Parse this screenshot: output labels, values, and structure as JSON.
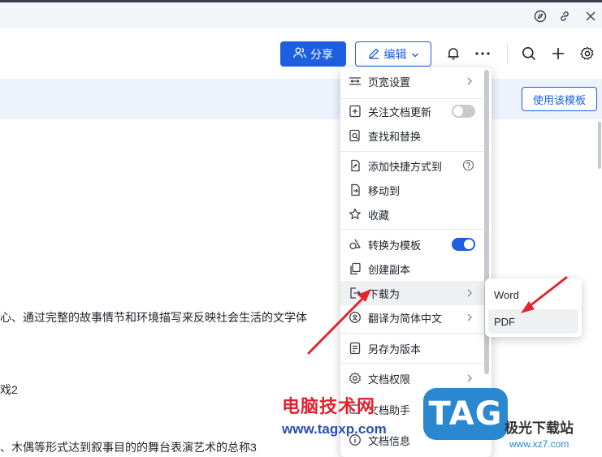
{
  "window_controls": {
    "compass_icon": "compass-icon",
    "link_icon": "link-icon",
    "close_icon": "close-icon"
  },
  "header": {
    "share_label": "分享",
    "edit_label": "编辑"
  },
  "banner": {
    "template_button": "使用该模板"
  },
  "doc_lines": [
    "心、通过完整的故事情节和环境描写来反映社会生活的文学体",
    "戏2",
    "、木偶等形式达到叙事目的的舞台表演艺术的总称3"
  ],
  "menu": {
    "items": [
      {
        "label": "页宽设置",
        "icon": "page-width-icon",
        "has_arrow": true
      },
      {
        "label": "关注文档更新",
        "icon": "follow-icon",
        "toggle": false
      },
      {
        "label": "查找和替换",
        "icon": "find-replace-icon"
      },
      {
        "label": "添加快捷方式到",
        "icon": "shortcut-icon",
        "has_help": true
      },
      {
        "label": "移动到",
        "icon": "move-icon"
      },
      {
        "label": "收藏",
        "icon": "star-icon"
      },
      {
        "label": "转换为模板",
        "icon": "template-icon",
        "toggle": true
      },
      {
        "label": "创建副本",
        "icon": "copy-icon"
      },
      {
        "label": "下载为",
        "icon": "download-icon",
        "has_arrow": true,
        "highlighted": true
      },
      {
        "label": "翻译为简体中文",
        "icon": "translate-icon",
        "has_arrow": true
      },
      {
        "label": "另存为版本",
        "icon": "save-version-icon"
      },
      {
        "label": "文档权限",
        "icon": "permission-icon",
        "has_arrow": true
      },
      {
        "label": "文档助手",
        "icon": "assistant-icon"
      },
      {
        "label": "文档信息",
        "icon": "info-icon"
      }
    ]
  },
  "submenu": {
    "items": [
      {
        "label": "Word"
      },
      {
        "label": "PDF",
        "highlighted": true
      }
    ]
  },
  "watermark": {
    "title": "电脑技术网",
    "url": "www.tagxp.com",
    "logo": "TAG",
    "site_name": "极光下载站",
    "site_url": "www.xz7.com"
  },
  "colors": {
    "accent": "#1d5fe0",
    "annotation_arrow": "#e0262f",
    "toggle_on": "#1d5fe0",
    "toggle_off": "#c9cbce"
  }
}
